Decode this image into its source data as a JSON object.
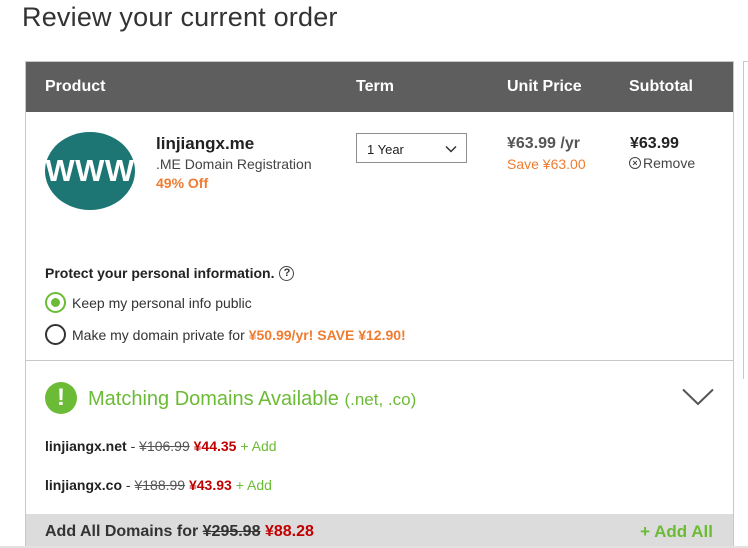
{
  "page": {
    "title": "Review your current order"
  },
  "table": {
    "headers": {
      "product": "Product",
      "term": "Term",
      "unit_price": "Unit Price",
      "subtotal": "Subtotal"
    }
  },
  "item": {
    "logo_text": "WWW",
    "domain": "linjiangx.me",
    "type": ".ME Domain Registration",
    "discount": "49% Off",
    "term_selected": "1 Year",
    "unit_price": "¥63.99 /yr",
    "unit_save": "Save ¥63.00",
    "subtotal": "¥63.99",
    "remove_label": "Remove"
  },
  "privacy": {
    "title": "Protect your personal information.",
    "help_icon": "?",
    "option_public": "Keep my personal info public",
    "option_private": "Make my domain private for",
    "private_offer": "¥50.99/yr! SAVE ¥12.90!",
    "selected": "public"
  },
  "matching": {
    "icon": "!",
    "title": "Matching Domains Available",
    "tlds": "(.net, .co)",
    "offers": [
      {
        "name": "linjiangx.net",
        "sep": " - ",
        "old_price": "¥106.99",
        "new_price": "¥44.35",
        "add_label": "+ Add"
      },
      {
        "name": "linjiangx.co",
        "sep": " - ",
        "old_price": "¥188.99",
        "new_price": "¥43.93",
        "add_label": "+ Add"
      }
    ],
    "add_all": {
      "label": "Add All Domains for",
      "old_price": "¥295.98",
      "new_price": "¥88.28",
      "button": "+ Add All"
    }
  },
  "colors": {
    "header_bg": "#5e5e5e",
    "accent_green": "#6cbb36",
    "accent_orange": "#ef7c30",
    "price_red": "#c00000",
    "logo_teal": "#1d7674"
  },
  "icons": {
    "term_dropdown": "chevron-down-icon",
    "remove": "close-circle-icon",
    "help": "question-circle-icon",
    "matching": "exclamation-circle-icon",
    "collapse": "chevron-down-icon"
  }
}
